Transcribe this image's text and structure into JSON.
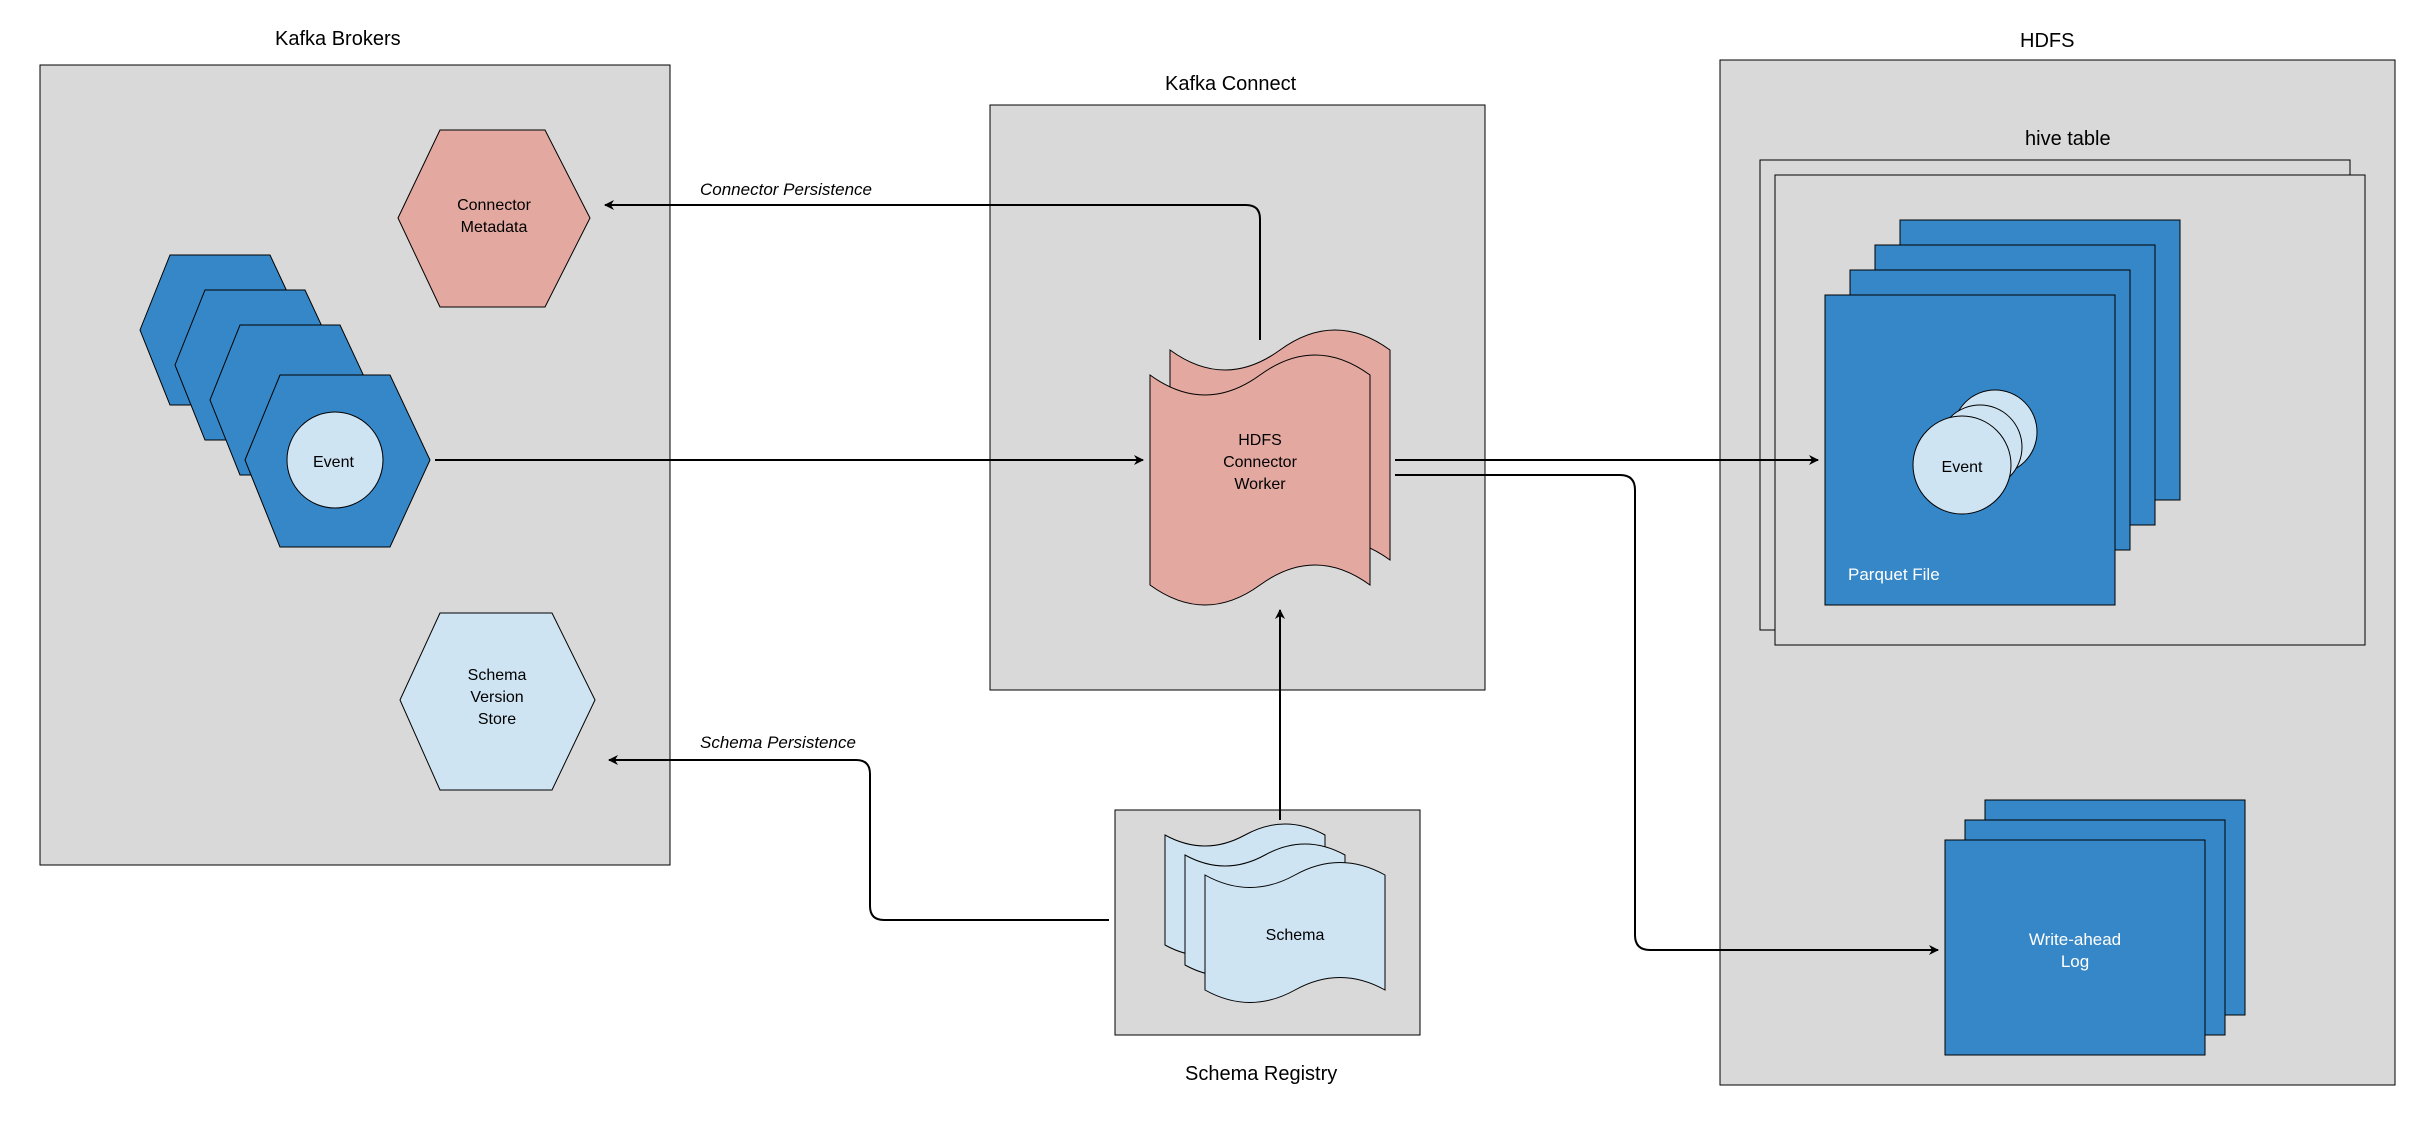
{
  "groups": {
    "kafka_brokers": "Kafka Brokers",
    "kafka_connect": "Kafka Connect",
    "hdfs": "HDFS",
    "schema_registry": "Schema Registry",
    "hive_table": "hive table"
  },
  "nodes": {
    "connector_metadata_l1": "Connector",
    "connector_metadata_l2": "Metadata",
    "event": "Event",
    "schema_version_store_l1": "Schema",
    "schema_version_store_l2": "Version",
    "schema_version_store_l3": "Store",
    "hdfs_connector_worker_l1": "HDFS",
    "hdfs_connector_worker_l2": "Connector",
    "hdfs_connector_worker_l3": "Worker",
    "schema": "Schema",
    "parquet_file": "Parquet File",
    "event_file": "Event",
    "wal_l1": "Write-ahead",
    "wal_l2": "Log"
  },
  "edges": {
    "connector_persistence": "Connector Persistence",
    "schema_persistence": "Schema Persistence"
  }
}
